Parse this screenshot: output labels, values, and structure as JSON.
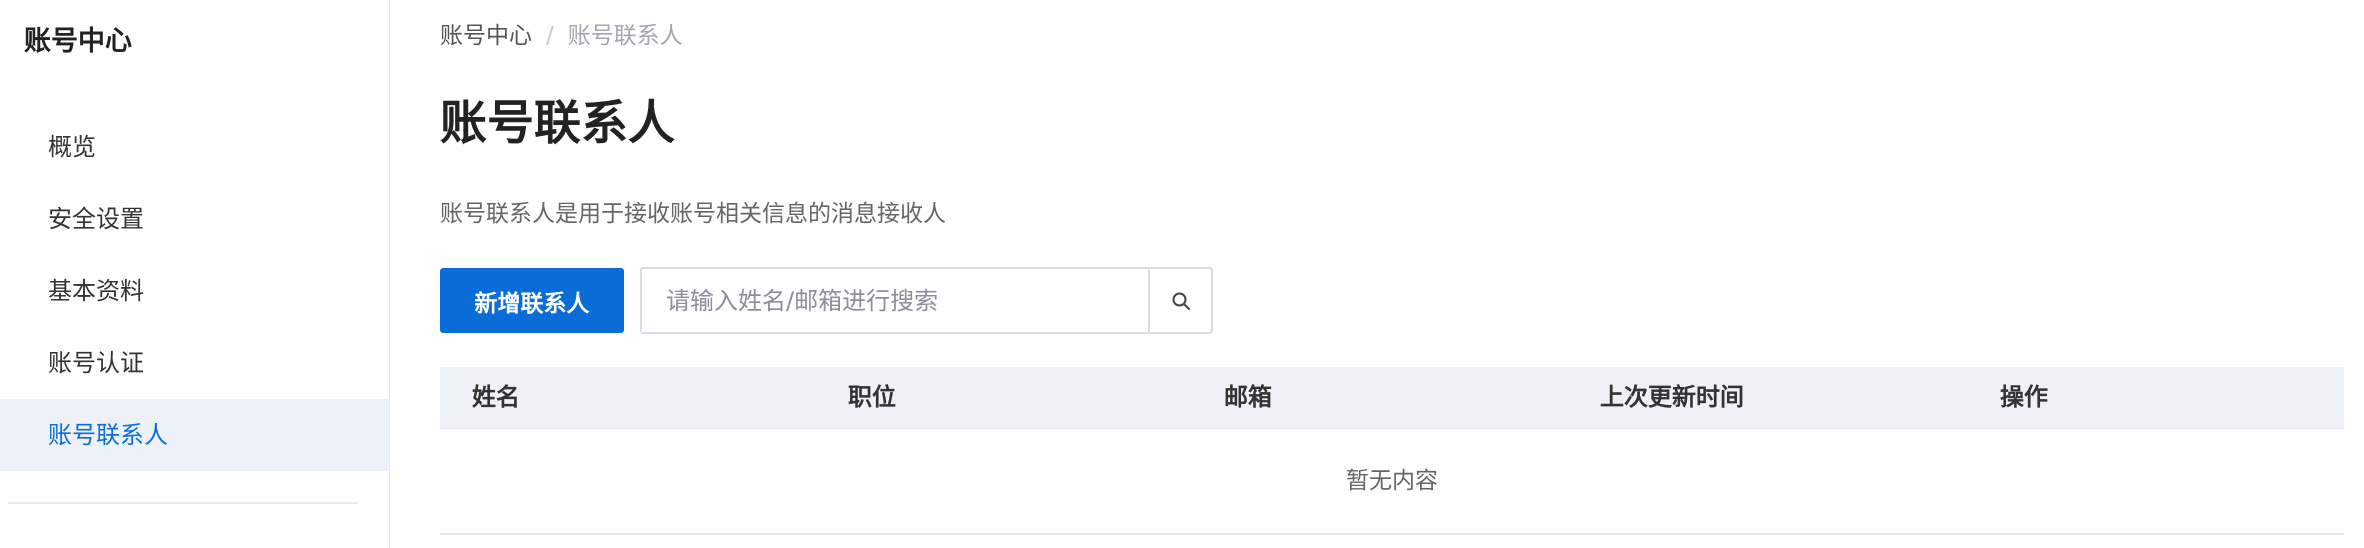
{
  "sidebar": {
    "title": "账号中心",
    "items": [
      {
        "label": "概览"
      },
      {
        "label": "安全设置"
      },
      {
        "label": "基本资料"
      },
      {
        "label": "账号认证"
      },
      {
        "label": "账号联系人"
      }
    ],
    "active_index": 4
  },
  "breadcrumb": {
    "parent": "账号中心",
    "separator": "/",
    "current": "账号联系人"
  },
  "main": {
    "title": "账号联系人",
    "description": "账号联系人是用于接收账号相关信息的消息接收人",
    "add_button_label": "新增联系人",
    "search": {
      "placeholder": "请输入姓名/邮箱进行搜索",
      "value": "",
      "icon": "search-icon"
    }
  },
  "table": {
    "columns": [
      "姓名",
      "职位",
      "邮箱",
      "上次更新时间",
      "操作"
    ],
    "rows": [],
    "empty_text": "暂无内容"
  },
  "colors": {
    "accent": "#0a6dd7",
    "active_nav_bg": "#edf1f9",
    "table_header_bg": "#eef1f8"
  }
}
